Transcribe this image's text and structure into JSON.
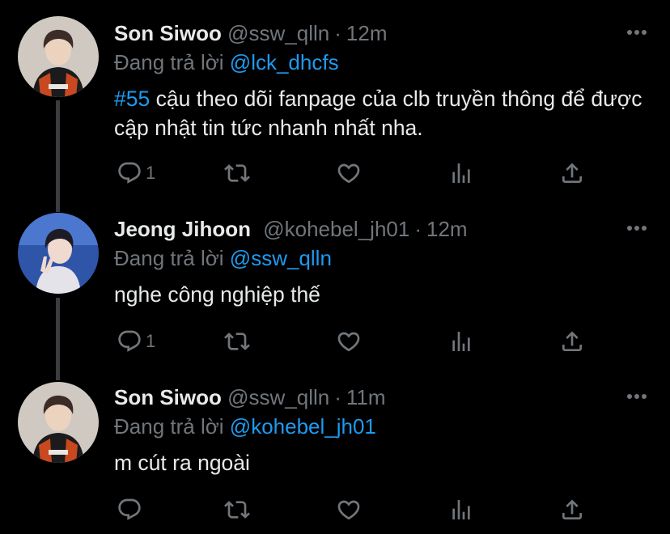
{
  "colors": {
    "background": "#000000",
    "text": "#e7e9ea",
    "muted": "#71767b",
    "accent": "#1d9bf0",
    "thread_line": "#3a3c3f"
  },
  "tweets": [
    {
      "name": "Son Siwoo",
      "handle": "@ssw_qlln",
      "separator": "·",
      "time": "12m",
      "replying_prefix": "Đang trả lời",
      "replying_to": "@lck_dhcfs",
      "hashtag": "#55",
      "text": " cậu theo dõi fanpage của clb truyền thông để được cập nhật tin tức nhanh nhất nha.",
      "reply_count": "1",
      "icons": [
        "reply-icon",
        "retweet-icon",
        "like-icon",
        "analytics-icon",
        "share-icon",
        "more-icon"
      ]
    },
    {
      "name": "Jeong Jihoon",
      "handle": "@kohebel_jh01",
      "separator": "·",
      "time": "12m",
      "replying_prefix": "Đang trả lời",
      "replying_to": "@ssw_qlln",
      "text": "nghe công nghiệp thế",
      "reply_count": "1",
      "icons": [
        "reply-icon",
        "retweet-icon",
        "like-icon",
        "analytics-icon",
        "share-icon",
        "more-icon"
      ]
    },
    {
      "name": "Son Siwoo",
      "handle": "@ssw_qlln",
      "separator": "·",
      "time": "11m",
      "replying_prefix": "Đang trả lời",
      "replying_to": "@kohebel_jh01",
      "text": "m cút ra ngoài",
      "reply_count": "",
      "icons": [
        "reply-icon",
        "retweet-icon",
        "like-icon",
        "analytics-icon",
        "share-icon",
        "more-icon"
      ]
    }
  ]
}
